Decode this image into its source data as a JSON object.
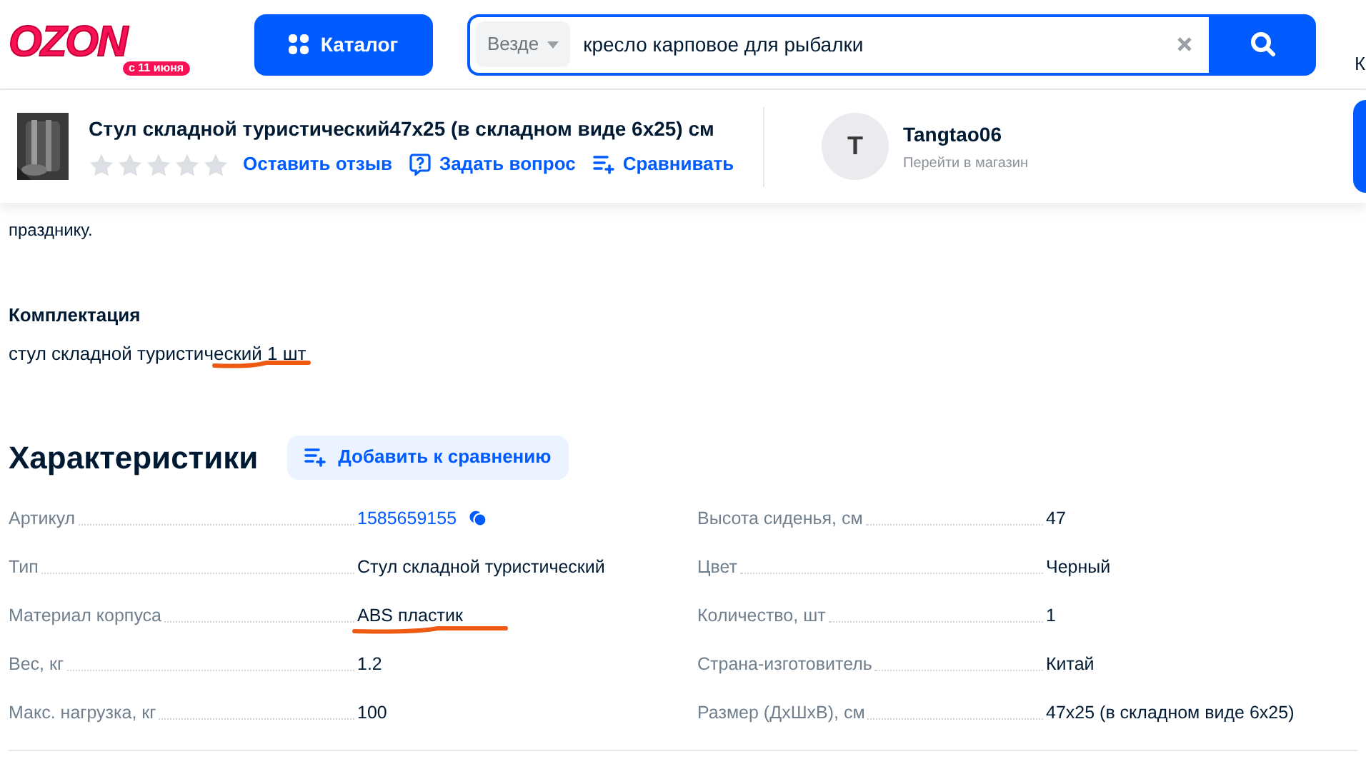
{
  "header": {
    "logo": {
      "text": "OZON",
      "badge": "с 11 июня"
    },
    "catalog_button": "Каталог",
    "search": {
      "scope": "Везде",
      "value": "кресло карповое для рыбалки"
    },
    "edge_text": "К"
  },
  "product_bar": {
    "title": "Стул складной туристический47x25 (в складном виде 6x25) см",
    "stars": 0,
    "actions": [
      {
        "kind": "review",
        "label": "Оставить отзыв"
      },
      {
        "kind": "question",
        "label": "Задать вопрос"
      },
      {
        "kind": "compare",
        "label": "Сравнивать"
      }
    ],
    "seller": {
      "initial": "T",
      "name": "Tangtao06",
      "link": "Перейти в магазин"
    }
  },
  "description": {
    "last_line": "празднику."
  },
  "kit": {
    "title": "Комплектация",
    "text": "стул складной туристический 1 шт",
    "annotated": true
  },
  "characteristics": {
    "title": "Характеристики",
    "compare_button": "Добавить к сравнению",
    "columns": [
      [
        {
          "label": "Артикул",
          "value": "1585659155",
          "kind": "link",
          "annotated": false
        },
        {
          "label": "Тип",
          "value": "Стул складной туристический",
          "kind": "text",
          "annotated": false
        },
        {
          "label": "Материал корпуса",
          "value": "ABS пластик",
          "kind": "text",
          "annotated": true
        },
        {
          "label": "Вес, кг",
          "value": "1.2",
          "kind": "text",
          "annotated": false
        },
        {
          "label": "Макс. нагрузка, кг",
          "value": "100",
          "kind": "text",
          "annotated": false
        }
      ],
      [
        {
          "label": "Высота сиденья, см",
          "value": "47",
          "kind": "text",
          "annotated": false
        },
        {
          "label": "Цвет",
          "value": "Черный",
          "kind": "text",
          "annotated": false
        },
        {
          "label": "Количество, шт",
          "value": "1",
          "kind": "text",
          "annotated": false
        },
        {
          "label": "Страна-изготовитель",
          "value": "Китай",
          "kind": "text",
          "annotated": false
        },
        {
          "label": "Размер (ДхШхВ), см",
          "value": "47x25 (в складном виде 6x25)",
          "kind": "text",
          "annotated": false
        }
      ]
    ]
  }
}
